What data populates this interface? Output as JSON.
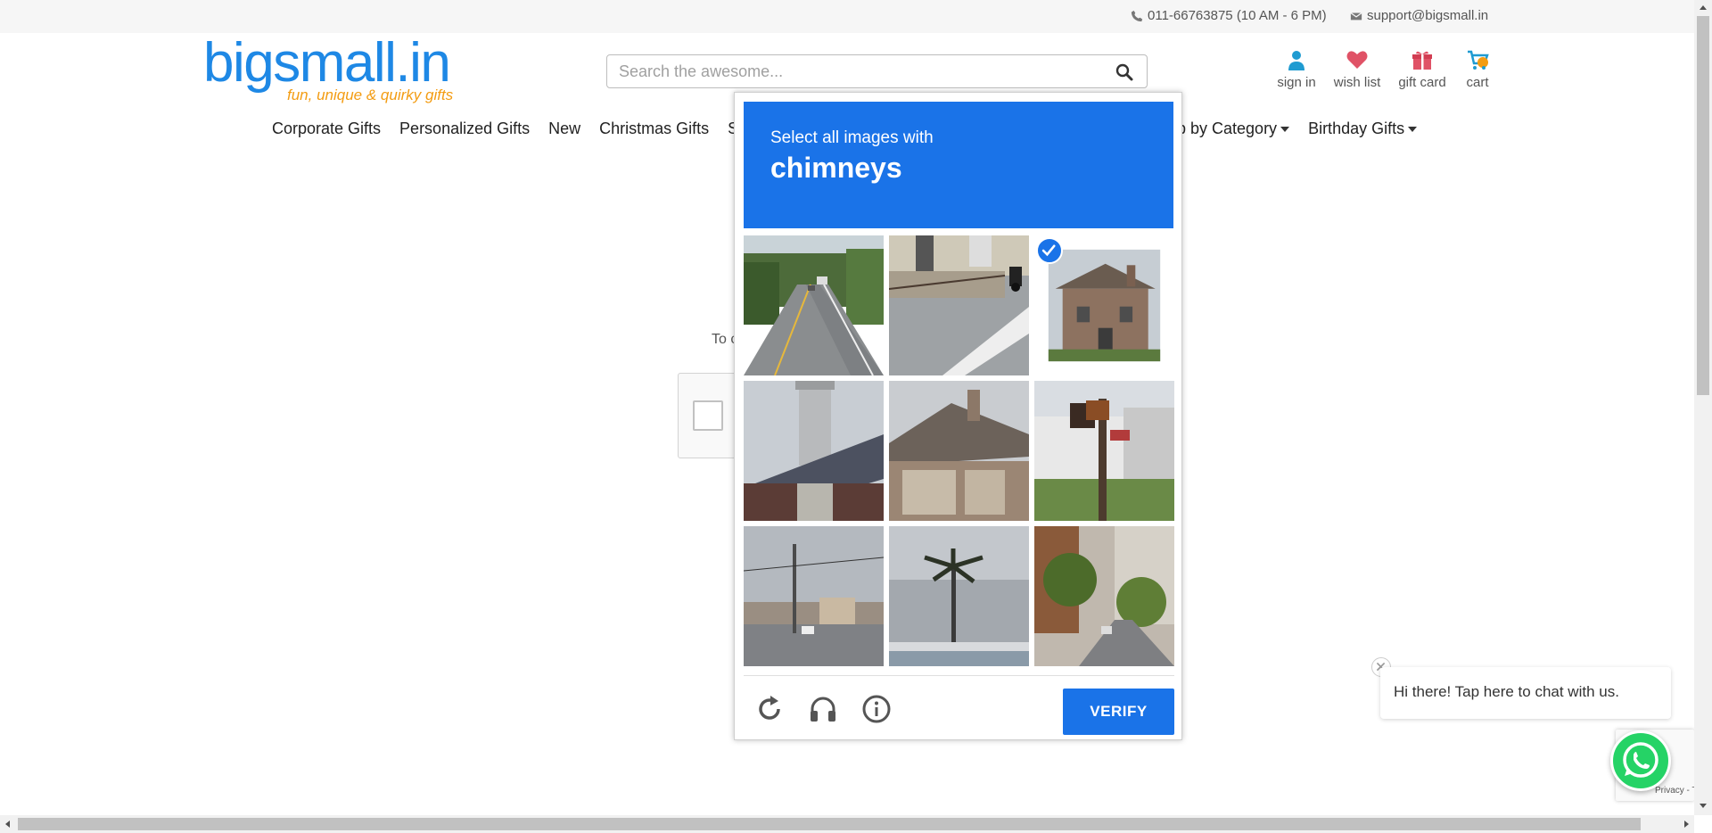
{
  "topbar": {
    "phone": "011-66763875 (10 AM - 6 PM)",
    "email": "support@bigsmall.in"
  },
  "logo": {
    "name": "bigsmall.in",
    "tagline": "fun, unique & quirky gifts"
  },
  "search": {
    "placeholder": "Search the awesome..."
  },
  "header_links": {
    "sign_in": "sign in",
    "wish_list": "wish list",
    "gift_card": "gift card",
    "cart": "cart"
  },
  "nav": {
    "left_items": [
      "Corporate Gifts",
      "Personalized Gifts",
      "New",
      "Christmas Gifts",
      "Se"
    ],
    "right_items": [
      "p by Category",
      "Birthday Gifts"
    ]
  },
  "background": {
    "partial_text": "To c"
  },
  "captcha": {
    "instruction": "Select all images with",
    "target": "chimneys",
    "verify_label": "VERIFY",
    "tiles": [
      {
        "scene": "road-forest",
        "selected": false
      },
      {
        "scene": "street-motorbike",
        "selected": false
      },
      {
        "scene": "house-chimney",
        "selected": true
      },
      {
        "scene": "roof-chimney-closeup",
        "selected": false
      },
      {
        "scene": "house-garage-chimney",
        "selected": false
      },
      {
        "scene": "traffic-light-pole",
        "selected": false
      },
      {
        "scene": "street-intersection",
        "selected": false
      },
      {
        "scene": "palm-tree-sky",
        "selected": false
      },
      {
        "scene": "city-street-trees",
        "selected": false
      }
    ]
  },
  "chat": {
    "message": "Hi there! Tap here to chat with us."
  },
  "recaptcha_badge": {
    "terms": "Privacy - Terms"
  },
  "colors": {
    "brand_blue": "#1e88e5",
    "brand_orange": "#f39c12",
    "captcha_blue": "#1a73e8",
    "whatsapp_green": "#25d366"
  }
}
